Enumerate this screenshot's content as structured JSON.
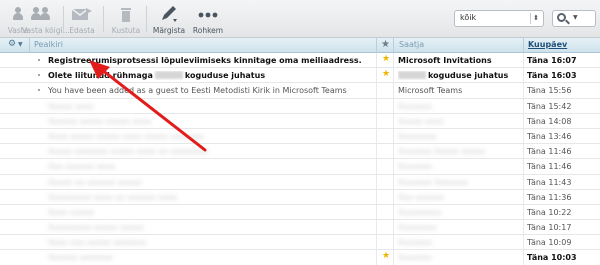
{
  "toolbar": {
    "buttons": [
      {
        "label": "Vasta"
      },
      {
        "label": "Vasta kõigi..."
      },
      {
        "label": "Edasta"
      },
      {
        "label": "Kustuta"
      },
      {
        "label": "Märgista"
      },
      {
        "label": "Rohkem"
      }
    ],
    "filter_value": "kõik",
    "filter_arrow": "⬍",
    "search_dropdown": "▼"
  },
  "list_header": {
    "settings_icon": "⚙",
    "subject": "Pealkiri",
    "flag_icon": "★",
    "sender": "Saatja",
    "date": "Kuupäev"
  },
  "messages": [
    {
      "subject": "Registreerumisprotsessi lõpuleviimiseks kinnitage oma meiliaadress.",
      "star": "★",
      "sender": "Microsoft Invitations",
      "date": "Täna 16:07",
      "style": "bold"
    },
    {
      "subject_a": "Olete liitunud rühmaga",
      "subject_b": "koguduse juhatus",
      "star": "★",
      "sender_b": "koguduse juhatus",
      "date": "Täna 16:03",
      "style": "bold"
    },
    {
      "subject": "You have been added as a guest to Eesti Metodisti Kirik in Microsoft Teams",
      "sender": "Microsoft Teams",
      "date": "Täna 15:56",
      "style": "plain"
    },
    {
      "subject": "Xxxxx xxxx",
      "sender": "Xxxxxxx",
      "date": "Täna 15:42",
      "style": "blur"
    },
    {
      "subject": "Xxxxxx xxxxx xxxxx xxxx",
      "sender": "Xxxxx xxxx",
      "date": "Täna 14:08",
      "style": "blur"
    },
    {
      "subject": "Xxxx xxxxx xxxxx xxxx xxxxx xxxxxxx",
      "sender": "Xxxxxxxx",
      "date": "Täna 13:46",
      "style": "blur"
    },
    {
      "subject": "Xxxxx xxxxxxx xxxxx xxxx xx xxxxxxxx",
      "sender": "Xxxxxxx Xxxxx xxxxx",
      "date": "Täna 11:46",
      "style": "blur"
    },
    {
      "subject": "Xxx xxxxxx xxxx",
      "sender": "Xxxxxxx",
      "date": "Täna 11:46",
      "style": "blur"
    },
    {
      "subject": "Xxxxx xx xxxxxx xxxxx",
      "sender": "Xxxxxxx Xxxxxxx",
      "date": "Täna 11:43",
      "style": "blur"
    },
    {
      "subject": "Xxxxxxxxx xxxx xx xxxxxx xxxx",
      "sender": "Xxx xxxxxx",
      "date": "Täna 11:36",
      "style": "blur"
    },
    {
      "subject": "Xxxx xxxxx",
      "sender": "Xxxxxxxxx",
      "date": "Täna 10:22",
      "style": "blur"
    },
    {
      "subject": "Xxxxxxxxx xxxxx xxxxx",
      "sender": "Xxxxxxxx",
      "date": "Täna 10:17",
      "style": "blur"
    },
    {
      "subject": "Xxxx xxx xxxxx xxxxxxx",
      "sender": "Xxxxxxx",
      "date": "Täna 10:09",
      "style": "blur"
    },
    {
      "subject": "Xxxxxx xxxxxxx",
      "star": "★",
      "sender": "Xxxxxxx",
      "date": "Täna 10:03",
      "style": "blur-bold"
    }
  ],
  "colors": {
    "accent": "#1d4f78",
    "arrow": "#e21b1b",
    "star": "#f0b400"
  }
}
